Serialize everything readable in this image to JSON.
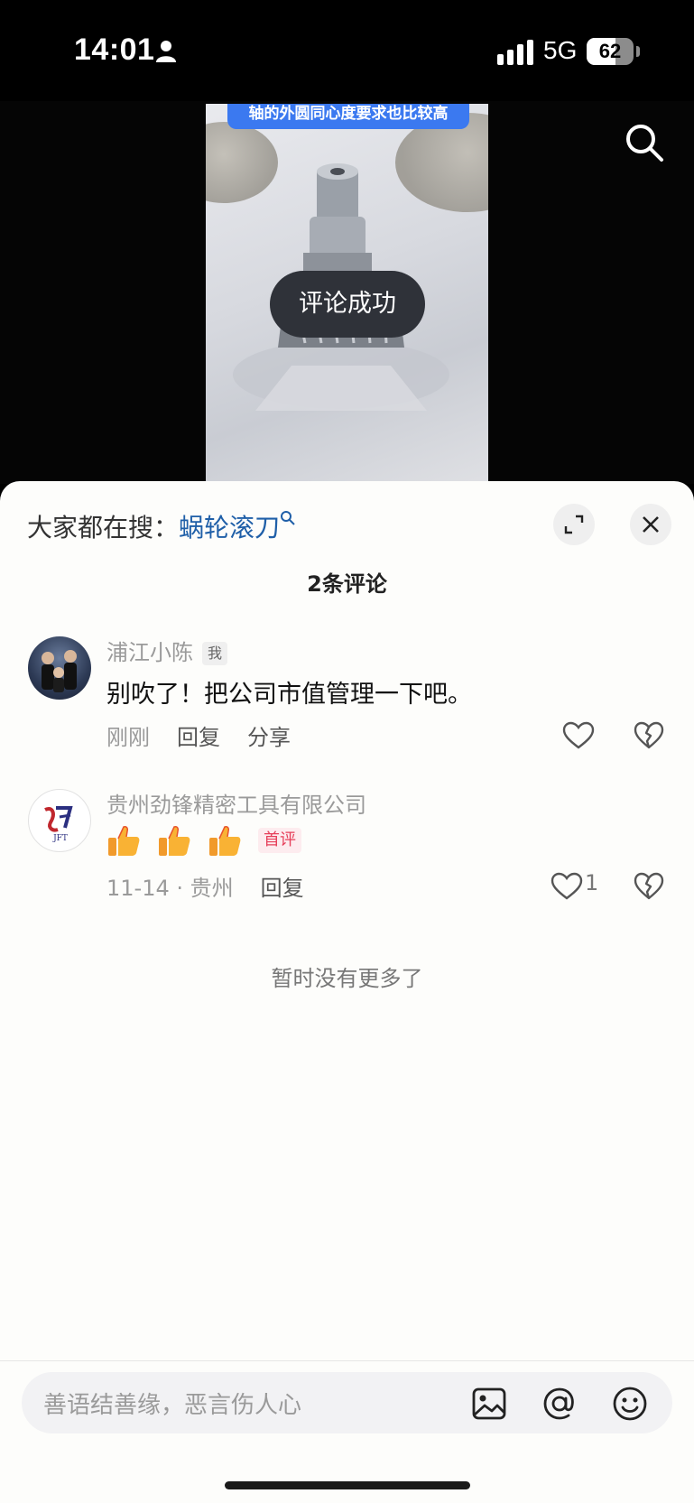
{
  "status_bar": {
    "time": "14:01",
    "network": "5G",
    "battery": "62",
    "battery_level": 0.62
  },
  "video": {
    "caption": "轴的外圆同心度要求也比较高",
    "toast": "评论成功"
  },
  "sheet": {
    "hot_search_prefix": "大家都在搜：",
    "hot_search_keyword": "蜗轮滚刀",
    "comment_count": "2条评论",
    "comments": [
      {
        "username": "浦江小陈",
        "badge": "我",
        "text": "别吹了！把公司市值管理一下吧。",
        "time": "刚刚",
        "reply": "回复",
        "share": "分享"
      },
      {
        "username": "贵州劲锋精密工具有限公司",
        "avatar_text": "JFT",
        "emoji": [
          "thumbs-up",
          "thumbs-up",
          "thumbs-up"
        ],
        "first_badge": "首评",
        "time_location": "11-14 · 贵州",
        "reply": "回复",
        "likes": "1"
      }
    ],
    "no_more": "暂时没有更多了"
  },
  "input": {
    "placeholder": "善语结善缘，恶言伤人心"
  },
  "colors": {
    "keyword_link": "#1f5fa8",
    "first_badge": "#e63f5a",
    "caption_bg": "#3b79f0"
  }
}
